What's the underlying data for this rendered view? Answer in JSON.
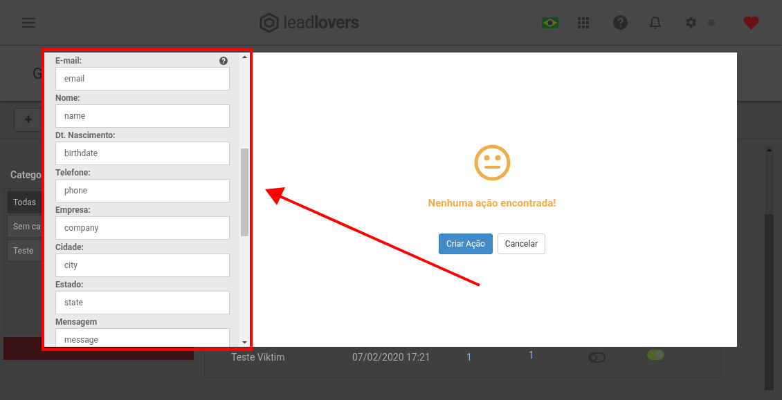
{
  "header": {
    "logo": {
      "light": "lead",
      "bold": "lovers"
    }
  },
  "page": {
    "title_fragment": "G",
    "add_button": "+",
    "categories_heading": "Catego",
    "categories": [
      {
        "label": "Todas",
        "selected": true
      },
      {
        "label": "Sem ca",
        "selected": false
      },
      {
        "label": "Teste",
        "selected": false
      }
    ],
    "table_rows": [
      {
        "name": "Teste Viktim",
        "date": "07/02/2020 17:21",
        "column_3": "1",
        "column_4": "1",
        "toggle_1_on": false,
        "toggle_2_on": true
      }
    ]
  },
  "modal": {
    "fields": [
      {
        "label": "E-mail:",
        "value": "email",
        "help": true
      },
      {
        "label": "Nome:",
        "value": "name",
        "help": false
      },
      {
        "label": "Dt. Nascimento:",
        "value": "birthdate",
        "help": false
      },
      {
        "label": "Telefone:",
        "value": "phone",
        "help": false
      },
      {
        "label": "Empresa:",
        "value": "company",
        "help": false
      },
      {
        "label": "Cidade:",
        "value": "city",
        "help": false
      },
      {
        "label": "Estado:",
        "value": "state",
        "help": false
      },
      {
        "label": "Mensagem",
        "value": "message",
        "help": false
      }
    ],
    "empty_state": {
      "message": "Nenhuma ação encontrada!",
      "buttons": [
        {
          "label": "Criar Ação",
          "kind": "primary"
        },
        {
          "label": "Cancelar",
          "kind": "secondary"
        }
      ]
    }
  }
}
